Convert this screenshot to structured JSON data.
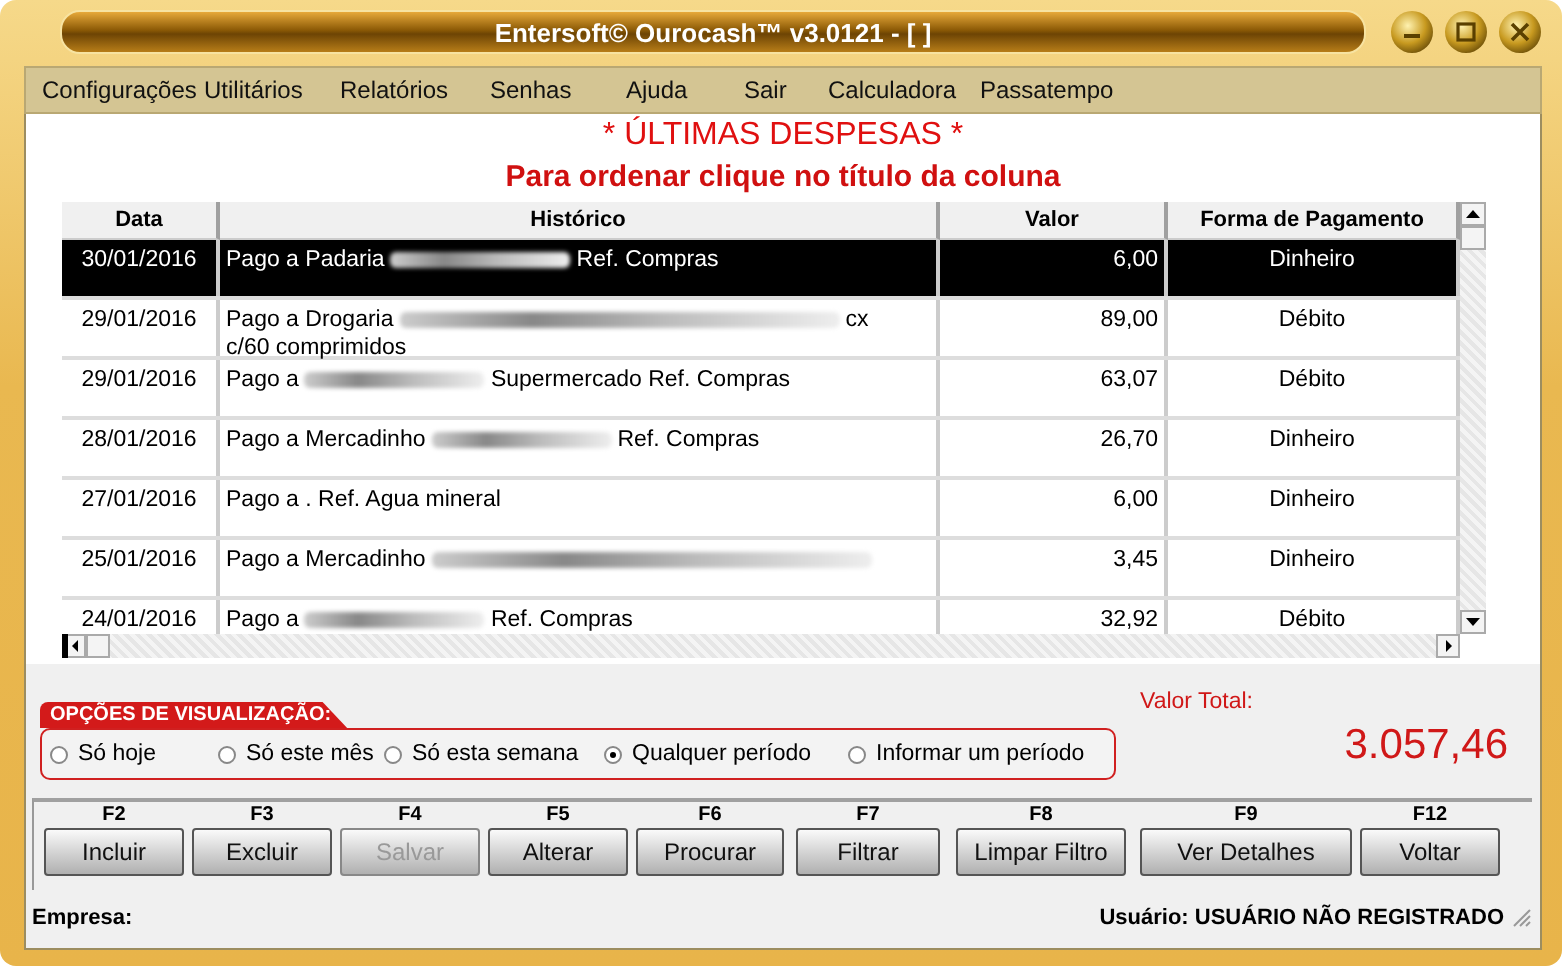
{
  "window": {
    "title": "Entersoft© Ourocash™ v3.0121 - [ ]"
  },
  "menu": [
    "Configurações",
    "Utilitários",
    "Relatórios",
    "Senhas",
    "Ajuda",
    "Sair",
    "Calculadora",
    "Passatempo"
  ],
  "heading": "* ÚLTIMAS DESPESAS *",
  "subheading": "Para ordenar clique no título da coluna",
  "table": {
    "columns": [
      "Data",
      "Histórico",
      "Valor",
      "Forma de Pagamento"
    ],
    "rows": [
      {
        "selected": true,
        "data": "30/01/2016",
        "historico": [
          {
            "kind": "text",
            "text": "Pago a Padaria"
          },
          {
            "kind": "blur"
          },
          {
            "kind": "text",
            "text": "Ref. Compras"
          }
        ],
        "valor": "6,00",
        "forma": "Dinheiro"
      },
      {
        "selected": false,
        "data": "29/01/2016",
        "historico": [
          {
            "kind": "text",
            "text": "Pago a Drogaria"
          },
          {
            "kind": "blur",
            "wide": true
          },
          {
            "kind": "text",
            "text": "cx"
          },
          {
            "kind": "break"
          },
          {
            "kind": "text",
            "text": "c/60 comprimidos"
          }
        ],
        "valor": "89,00",
        "forma": "Débito"
      },
      {
        "selected": false,
        "data": "29/01/2016",
        "historico": [
          {
            "kind": "text",
            "text": "Pago a"
          },
          {
            "kind": "blur"
          },
          {
            "kind": "text",
            "text": "Supermercado Ref. Compras"
          }
        ],
        "valor": "63,07",
        "forma": "Débito"
      },
      {
        "selected": false,
        "data": "28/01/2016",
        "historico": [
          {
            "kind": "text",
            "text": "Pago a Mercadinho"
          },
          {
            "kind": "blur"
          },
          {
            "kind": "text",
            "text": "Ref. Compras"
          }
        ],
        "valor": "26,70",
        "forma": "Dinheiro"
      },
      {
        "selected": false,
        "data": "27/01/2016",
        "historico": [
          {
            "kind": "text",
            "text": "Pago a . Ref. Agua mineral"
          }
        ],
        "valor": "6,00",
        "forma": "Dinheiro"
      },
      {
        "selected": false,
        "data": "25/01/2016",
        "historico": [
          {
            "kind": "text",
            "text": "Pago a Mercadinho"
          },
          {
            "kind": "blur",
            "wide": true
          }
        ],
        "valor": "3,45",
        "forma": "Dinheiro"
      },
      {
        "selected": false,
        "data": "24/01/2016",
        "historico": [
          {
            "kind": "text",
            "text": "Pago a"
          },
          {
            "kind": "blur"
          },
          {
            "kind": "text",
            "text": "Ref. Compras"
          }
        ],
        "valor": "32,92",
        "forma": "Débito"
      }
    ]
  },
  "options": {
    "title": "OPÇÕES DE VISUALIZAÇÃO:",
    "items": [
      {
        "label": "Só hoje",
        "selected": false
      },
      {
        "label": "Só este mês",
        "selected": false
      },
      {
        "label": "Só esta semana",
        "selected": false
      },
      {
        "label": "Qualquer período",
        "selected": true
      },
      {
        "label": "Informar um período",
        "selected": false
      }
    ]
  },
  "total": {
    "label": "Valor Total:",
    "value": "3.057,46"
  },
  "buttons": [
    {
      "key": "F2",
      "label": "Incluir",
      "disabled": false
    },
    {
      "key": "F3",
      "label": "Excluir",
      "disabled": false
    },
    {
      "key": "F4",
      "label": "Salvar",
      "disabled": true
    },
    {
      "key": "F5",
      "label": "Alterar",
      "disabled": false
    },
    {
      "key": "F6",
      "label": "Procurar",
      "disabled": false
    },
    {
      "key": "F7",
      "label": "Filtrar",
      "disabled": false
    },
    {
      "key": "F8",
      "label": "Limpar Filtro",
      "disabled": false
    },
    {
      "key": "F9",
      "label": "Ver Detalhes",
      "disabled": false
    },
    {
      "key": "F12",
      "label": "Voltar",
      "disabled": false
    }
  ],
  "status_bar": {
    "left": "Empresa:",
    "right": "Usuário: USUÁRIO NÃO REGISTRADO"
  }
}
